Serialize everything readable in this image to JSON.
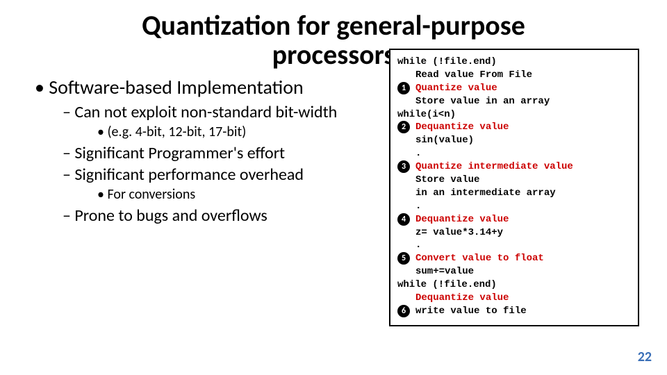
{
  "title": "Quantization for general-purpose processors",
  "bullets": {
    "l1a": "Software-based Implementation",
    "l2a": "Can not exploit non-standard bit-width",
    "l3a": "(e.g. 4-bit, 12-bit, 17-bit)",
    "l2b": "Significant Programmer's effort",
    "l2c": "Significant performance overhead",
    "l3b": "For conversions",
    "l2d": "Prone to bugs and overflows"
  },
  "code": {
    "l01": "while (!file.end)",
    "l02": "Read value From File",
    "l03": "Quantize value",
    "l04": "Store value in an array",
    "l05": "while(i<n)",
    "l06": "Dequantize value",
    "l07": "sin(value)",
    "l08": ".",
    "l09": "Quantize intermediate value",
    "l10": "Store value",
    "l11": "in an intermediate array",
    "l12": ".",
    "l13": "Dequantize value",
    "l14": "z= value*3.14+y",
    "l15": ".",
    "l16": "Convert value to float",
    "l17": "sum+=value",
    "l18": "while (!file.end)",
    "l19": "Dequantize value",
    "l20": "write value to file"
  },
  "bubble": {
    "n1": "1",
    "n2": "2",
    "n3": "3",
    "n4": "4",
    "n5": "5",
    "n6": "6"
  },
  "page": "22"
}
